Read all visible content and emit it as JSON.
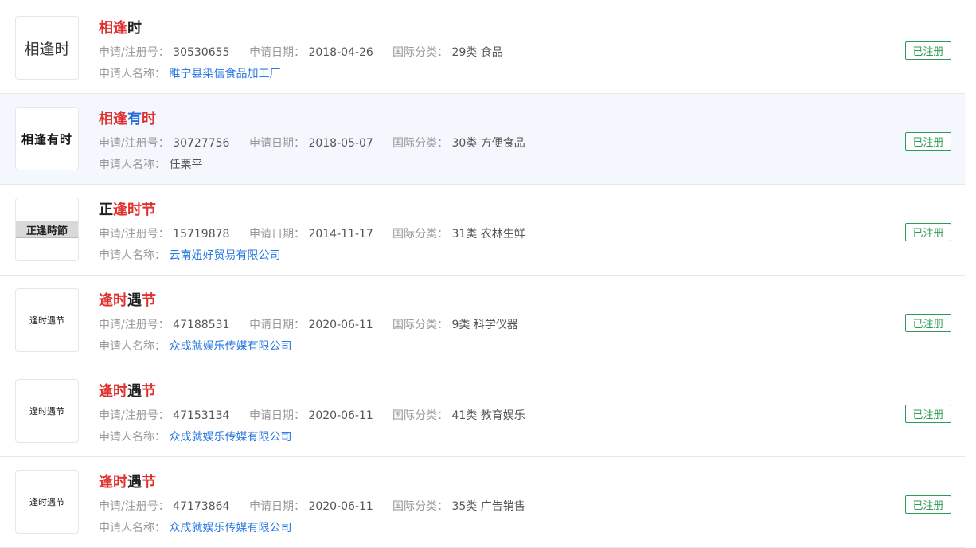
{
  "labels": {
    "reg_no": "申请/注册号：",
    "date": "申请日期：",
    "class": "国际分类：",
    "applicant": "申请人名称："
  },
  "items": [
    {
      "logo_text": "相逢时",
      "title_parts": [
        {
          "text": "相逢",
          "color": "red"
        },
        {
          "text": "时",
          "color": "black"
        }
      ],
      "reg_no": "30530655",
      "date": "2018-04-26",
      "class": "29类 食品",
      "applicant": "睢宁县染信食品加工厂",
      "applicant_link": true,
      "status": "已注册"
    },
    {
      "logo_text": "相逢有时",
      "title_parts": [
        {
          "text": "相逢",
          "color": "red"
        },
        {
          "text": "有",
          "color": "blue"
        },
        {
          "text": "时",
          "color": "red"
        }
      ],
      "reg_no": "30727756",
      "date": "2018-05-07",
      "class": "30类 方便食品",
      "applicant": "任栗平",
      "applicant_link": false,
      "status": "已注册"
    },
    {
      "logo_text": "正逢時節",
      "title_parts": [
        {
          "text": "正",
          "color": "black"
        },
        {
          "text": "逢时节",
          "color": "red"
        }
      ],
      "reg_no": "15719878",
      "date": "2014-11-17",
      "class": "31类 农林生鲜",
      "applicant": "云南妞好贸易有限公司",
      "applicant_link": true,
      "status": "已注册"
    },
    {
      "logo_text": "逢时遇节",
      "title_parts": [
        {
          "text": "逢时",
          "color": "red"
        },
        {
          "text": "遇",
          "color": "black"
        },
        {
          "text": "节",
          "color": "red"
        }
      ],
      "reg_no": "47188531",
      "date": "2020-06-11",
      "class": "9类 科学仪器",
      "applicant": "众成就娱乐传媒有限公司",
      "applicant_link": true,
      "status": "已注册"
    },
    {
      "logo_text": "逢时遇节",
      "title_parts": [
        {
          "text": "逢时",
          "color": "red"
        },
        {
          "text": "遇",
          "color": "black"
        },
        {
          "text": "节",
          "color": "red"
        }
      ],
      "reg_no": "47153134",
      "date": "2020-06-11",
      "class": "41类 教育娱乐",
      "applicant": "众成就娱乐传媒有限公司",
      "applicant_link": true,
      "status": "已注册"
    },
    {
      "logo_text": "逢时遇节",
      "title_parts": [
        {
          "text": "逢时",
          "color": "red"
        },
        {
          "text": "遇",
          "color": "black"
        },
        {
          "text": "节",
          "color": "red"
        }
      ],
      "reg_no": "47173864",
      "date": "2020-06-11",
      "class": "35类 广告销售",
      "applicant": "众成就娱乐传媒有限公司",
      "applicant_link": true,
      "status": "已注册"
    }
  ],
  "colors": {
    "red": "#e0312f",
    "blue": "#2a6fd8",
    "link": "#2a7ae2",
    "green": "#2f9b57"
  }
}
